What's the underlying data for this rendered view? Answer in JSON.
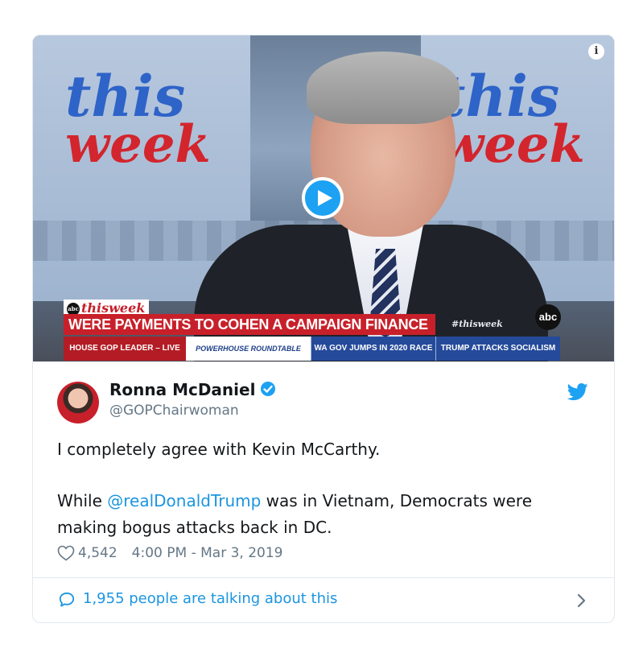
{
  "video": {
    "background_logo_line1": "this",
    "background_logo_line2": "week",
    "info_glyph": "i",
    "lower_third": {
      "brand_badge": "abc",
      "brand": "thisweek",
      "headline": "WERE PAYMENTS TO COHEN A CAMPAIGN FINANCE CRIME?",
      "hashtag": "#thisweek",
      "network_logo": "abc",
      "ticker": [
        "HOUSE GOP LEADER – LIVE",
        "POWERHOUSE ROUNDTABLE",
        "WA GOV JUMPS IN 2020 RACE",
        "TRUMP ATTACKS SOCIALISM"
      ]
    }
  },
  "author": {
    "name": "Ronna McDaniel",
    "handle": "@GOPChairwoman",
    "verified": true
  },
  "tweet": {
    "line1": "I completely agree with Kevin McCarthy.",
    "line2_prefix": "While ",
    "mention": "@realDonaldTrump",
    "line2_suffix": " was in Vietnam, Democrats were making bogus attacks back in DC."
  },
  "meta": {
    "likes": "4,542",
    "timestamp": "4:00 PM - Mar 3, 2019"
  },
  "footer": {
    "talking": "1,955 people are talking about this"
  },
  "icons": {
    "play": "play-icon",
    "info": "info-icon",
    "verified": "verified-badge-icon",
    "twitter": "twitter-bird-icon",
    "heart": "heart-icon",
    "comment": "speech-bubble-icon",
    "chevron": "chevron-right-icon"
  },
  "colors": {
    "accent": "#1da1f2",
    "link": "#1b95e0",
    "muted": "#657786",
    "text": "#14171a",
    "border": "#e1e8ed",
    "headline_red": "#c8202a"
  }
}
